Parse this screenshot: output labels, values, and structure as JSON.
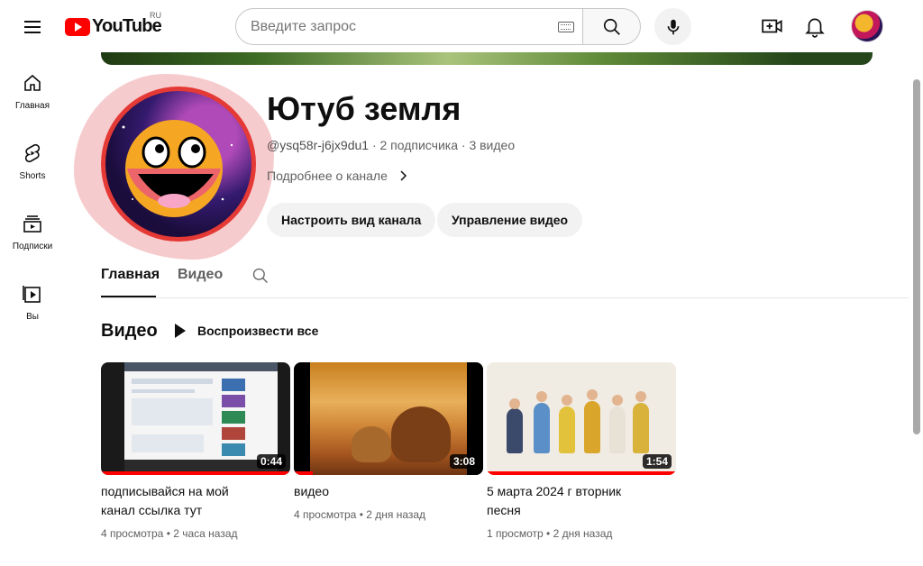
{
  "header": {
    "logo_text": "YouTube",
    "region": "RU",
    "search_placeholder": "Введите запрос",
    "icons": [
      "menu-icon",
      "keyboard-icon",
      "search-icon",
      "mic-icon",
      "create-video-icon",
      "bell-icon",
      "avatar"
    ]
  },
  "sidebar": {
    "items": [
      {
        "label": "Главная",
        "icon": "home-icon"
      },
      {
        "label": "Shorts",
        "icon": "shorts-icon"
      },
      {
        "label": "Подписки",
        "icon": "subscriptions-icon"
      },
      {
        "label": "Вы",
        "icon": "you-icon"
      }
    ]
  },
  "channel": {
    "title": "Ютуб земля",
    "handle": "@ysq58r-j6jx9du1",
    "subscribers": "2 подписчика",
    "video_count": "3 видео",
    "more_about": "Подробнее о канале",
    "buttons": {
      "customize": "Настроить вид канала",
      "manage": "Управление видео"
    }
  },
  "tabs": [
    {
      "label": "Главная",
      "active": true
    },
    {
      "label": "Видео",
      "active": false
    }
  ],
  "section": {
    "title": "Видео",
    "play_all": "Воспроизвести все"
  },
  "videos": [
    {
      "title_line1": "подписывайся на мой",
      "title_line2": "канал ссылка тут",
      "duration": "0:44",
      "views": "4 просмотра",
      "age": "2 часа назад"
    },
    {
      "title_line1": "видео",
      "title_line2": "",
      "duration": "3:08",
      "views": "4 просмотра",
      "age": "2 дня назад"
    },
    {
      "title_line1": "5 марта 2024 г вторник",
      "title_line2": "песня",
      "duration": "1:54",
      "views": "1 просмотр",
      "age": "2 дня назад"
    }
  ],
  "colors": {
    "brand_red": "#ff0000",
    "avatar_ring": "#e53935",
    "annotation_pink": "#f4c2c4"
  }
}
